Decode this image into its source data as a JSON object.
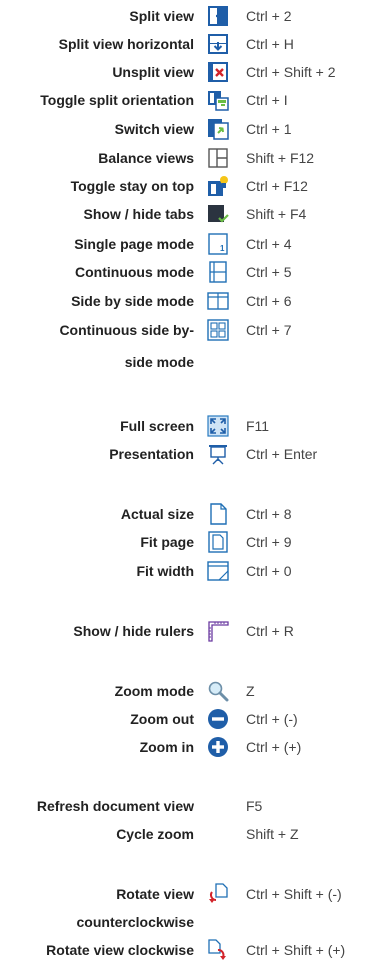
{
  "sections": [
    {
      "items": [
        {
          "label": "Split view",
          "shortcut": "Ctrl + 2",
          "icon": "split-view-icon"
        },
        {
          "label": "Split view horizontal",
          "shortcut": "Ctrl + H",
          "icon": "split-horizontal-icon"
        },
        {
          "label": "Unsplit view",
          "shortcut": "Ctrl + Shift + 2",
          "icon": "unsplit-view-icon"
        },
        {
          "label": "Toggle split orientation",
          "shortcut": "Ctrl + I",
          "icon": "toggle-orientation-icon"
        },
        {
          "label": "Switch view",
          "shortcut": "Ctrl + 1",
          "icon": "switch-view-icon"
        },
        {
          "label": "Balance views",
          "shortcut": "Shift + F12",
          "icon": "balance-views-icon"
        },
        {
          "label": "Toggle stay on top",
          "shortcut": "Ctrl + F12",
          "icon": "stay-on-top-icon"
        },
        {
          "label": "Show / hide tabs",
          "shortcut": "Shift + F4",
          "icon": "tabs-icon"
        },
        {
          "label": "Single page mode",
          "shortcut": "Ctrl + 4",
          "icon": "single-page-icon"
        },
        {
          "label": "Continuous mode",
          "shortcut": "Ctrl + 5",
          "icon": "continuous-mode-icon"
        },
        {
          "label": "Side by side mode",
          "shortcut": "Ctrl + 6",
          "icon": "side-by-side-icon"
        },
        {
          "label": "Continuous side by-",
          "label2": "side mode",
          "shortcut": "Ctrl + 7",
          "icon": "continuous-side-by-side-icon"
        }
      ]
    },
    {
      "items": [
        {
          "label": "Full screen",
          "shortcut": "F11",
          "icon": "full-screen-icon"
        },
        {
          "label": "Presentation",
          "shortcut": "Ctrl + Enter",
          "icon": "presentation-icon"
        }
      ]
    },
    {
      "items": [
        {
          "label": "Actual size",
          "shortcut": "Ctrl + 8",
          "icon": "actual-size-icon"
        },
        {
          "label": "Fit page",
          "shortcut": "Ctrl + 9",
          "icon": "fit-page-icon"
        },
        {
          "label": "Fit width",
          "shortcut": "Ctrl + 0",
          "icon": "fit-width-icon"
        }
      ]
    },
    {
      "items": [
        {
          "label": "Show / hide rulers",
          "shortcut": "Ctrl + R",
          "icon": "rulers-icon"
        }
      ]
    },
    {
      "items": [
        {
          "label": "Zoom mode",
          "shortcut": "Z",
          "icon": "magnifier-icon"
        },
        {
          "label": "Zoom out",
          "shortcut": "Ctrl + (-)",
          "icon": "zoom-out-icon"
        },
        {
          "label": "Zoom in",
          "shortcut": "Ctrl + (+)",
          "icon": "zoom-in-icon"
        }
      ]
    },
    {
      "items": [
        {
          "label": "Refresh document view",
          "shortcut": "F5",
          "icon": ""
        },
        {
          "label": "Cycle zoom",
          "shortcut": "Shift + Z",
          "icon": ""
        }
      ]
    },
    {
      "items": [
        {
          "label": "Rotate view",
          "label2": "counterclockwise",
          "shortcut": "Ctrl + Shift + (-)",
          "icon": "rotate-ccw-icon"
        },
        {
          "label": "Rotate view clockwise",
          "shortcut": "Ctrl + Shift + (+)",
          "icon": "rotate-cw-icon"
        }
      ]
    }
  ]
}
